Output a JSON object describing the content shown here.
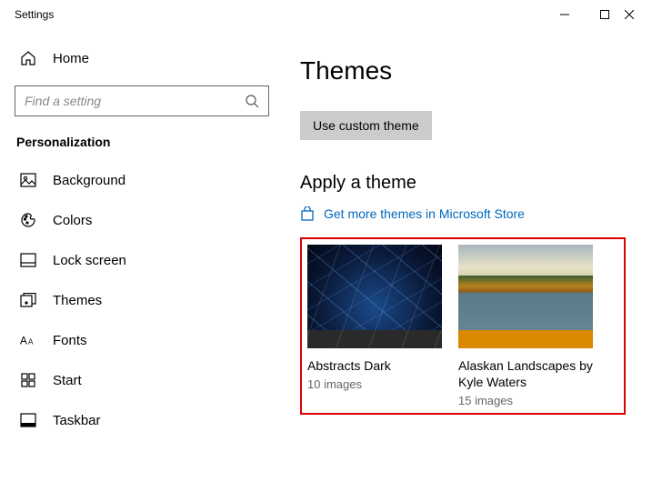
{
  "titlebar": {
    "title": "Settings"
  },
  "sidebar": {
    "home": "Home",
    "search_placeholder": "Find a setting",
    "category": "Personalization",
    "items": [
      {
        "label": "Background"
      },
      {
        "label": "Colors"
      },
      {
        "label": "Lock screen"
      },
      {
        "label": "Themes"
      },
      {
        "label": "Fonts"
      },
      {
        "label": "Start"
      },
      {
        "label": "Taskbar"
      }
    ]
  },
  "main": {
    "title": "Themes",
    "custom_btn": "Use custom theme",
    "apply_title": "Apply a theme",
    "store_link": "Get more themes in Microsoft Store",
    "themes": [
      {
        "name": "Abstracts Dark",
        "count": "10 images"
      },
      {
        "name": "Alaskan Landscapes by Kyle Waters",
        "count": "15 images"
      }
    ]
  }
}
